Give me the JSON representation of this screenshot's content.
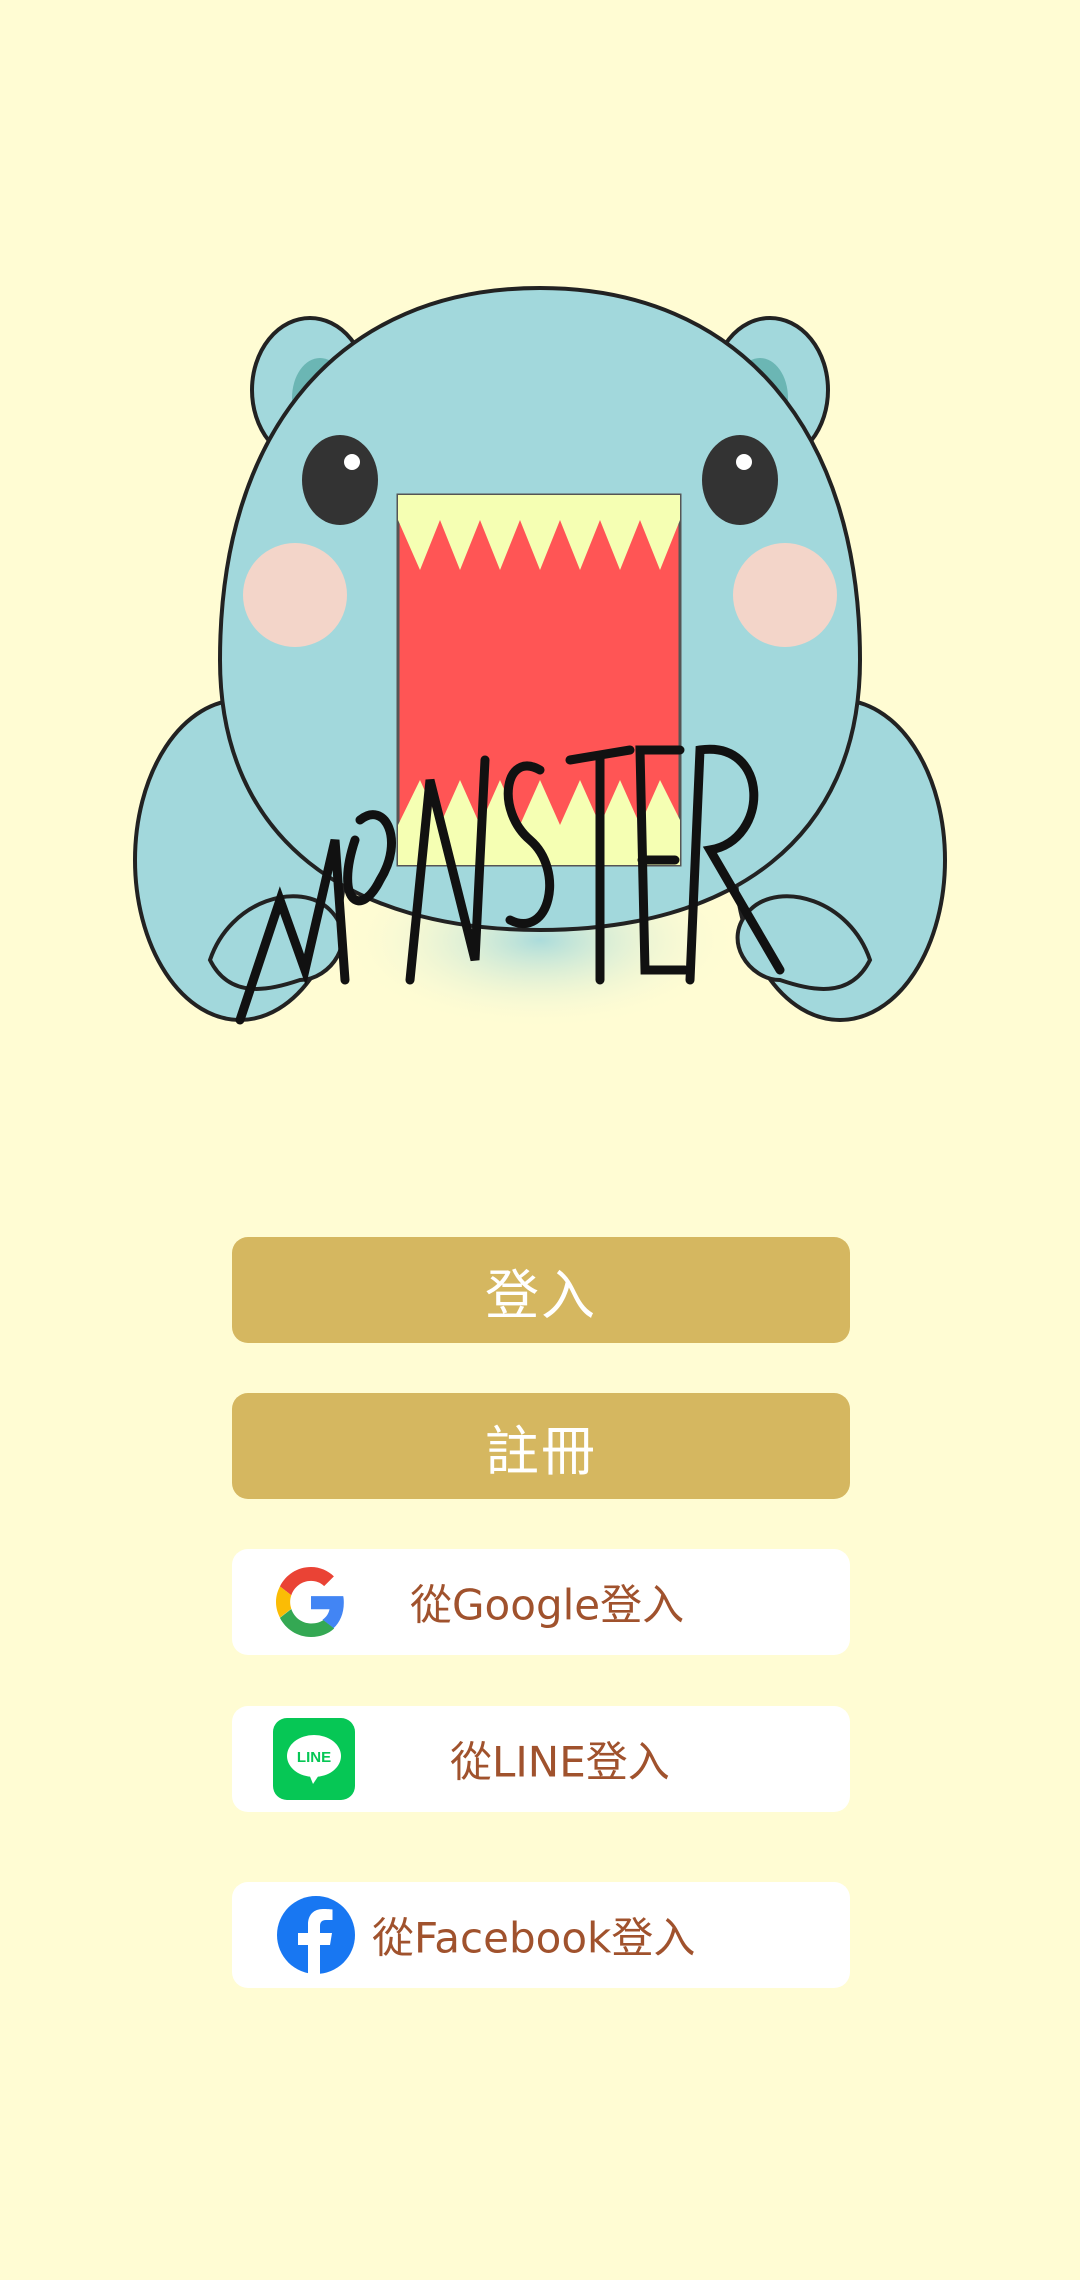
{
  "app": {
    "logo_icon": "monster-mascot-icon",
    "logo_wordmark": "MONSTER"
  },
  "auth": {
    "login_label": "登入",
    "register_label": "註冊",
    "google_label": "從Google登入",
    "line_label": "從LINE登入",
    "facebook_label": "從Facebook登入",
    "google_icon": "google-icon",
    "line_icon": "line-icon",
    "line_icon_text": "LINE",
    "facebook_icon": "facebook-icon"
  },
  "colors": {
    "background": "#FFFCD3",
    "primary_button": "#D5B760",
    "primary_button_text": "#FFFFFF",
    "social_button": "#FFFFFF",
    "social_button_text": "#A0522D",
    "line_green": "#06C755",
    "facebook_blue": "#1877F2",
    "mascot_body": "#A2D8DC",
    "mascot_mouth": "#FF5555",
    "mascot_teeth": "#F5FFB3"
  }
}
